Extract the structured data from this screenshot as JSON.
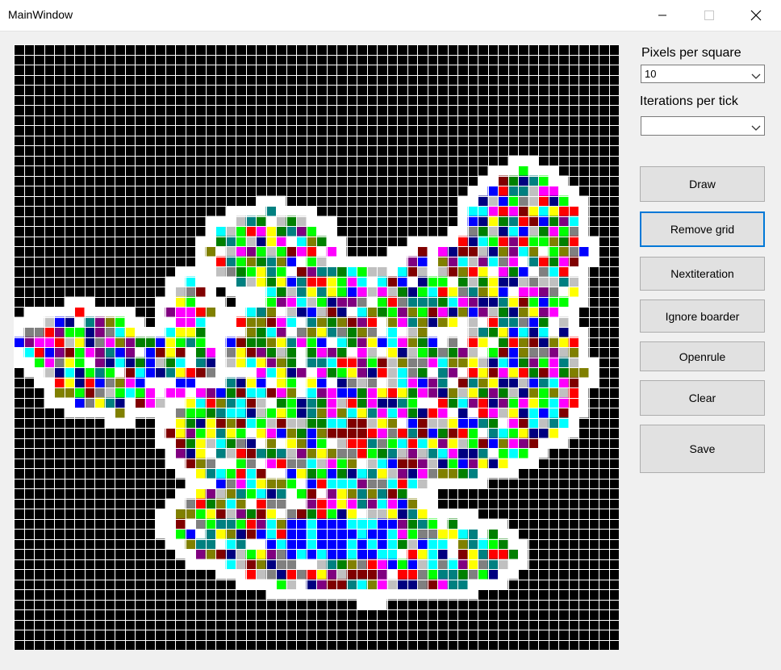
{
  "window": {
    "title": "MainWindow",
    "controls": [
      "minimize-icon",
      "maximize-icon",
      "close-icon"
    ]
  },
  "sidebar": {
    "pixels_label": "Pixels per square",
    "pixels_value": "10",
    "iterations_label": "Iterations per tick",
    "iterations_value": "",
    "buttons": {
      "draw": "Draw",
      "remove_grid": "Remove grid",
      "next_iteration": "Nextiteration",
      "ignore_boarder": "Ignore boarder",
      "open_rule": "Openrule",
      "clear": "Clear",
      "save": "Save"
    }
  },
  "grid": {
    "columns": 60,
    "rows": 60,
    "background": "#000000",
    "grid_line_color": "#ffffff",
    "palette": [
      "#ffffff",
      "#ffff00",
      "#00ffff",
      "#0000ff",
      "#ff0000",
      "#00ff00",
      "#ff00ff",
      "#c0c0c0",
      "#808080",
      "#800080",
      "#008000",
      "#808000",
      "#008080",
      "#000080",
      "#800000"
    ]
  }
}
